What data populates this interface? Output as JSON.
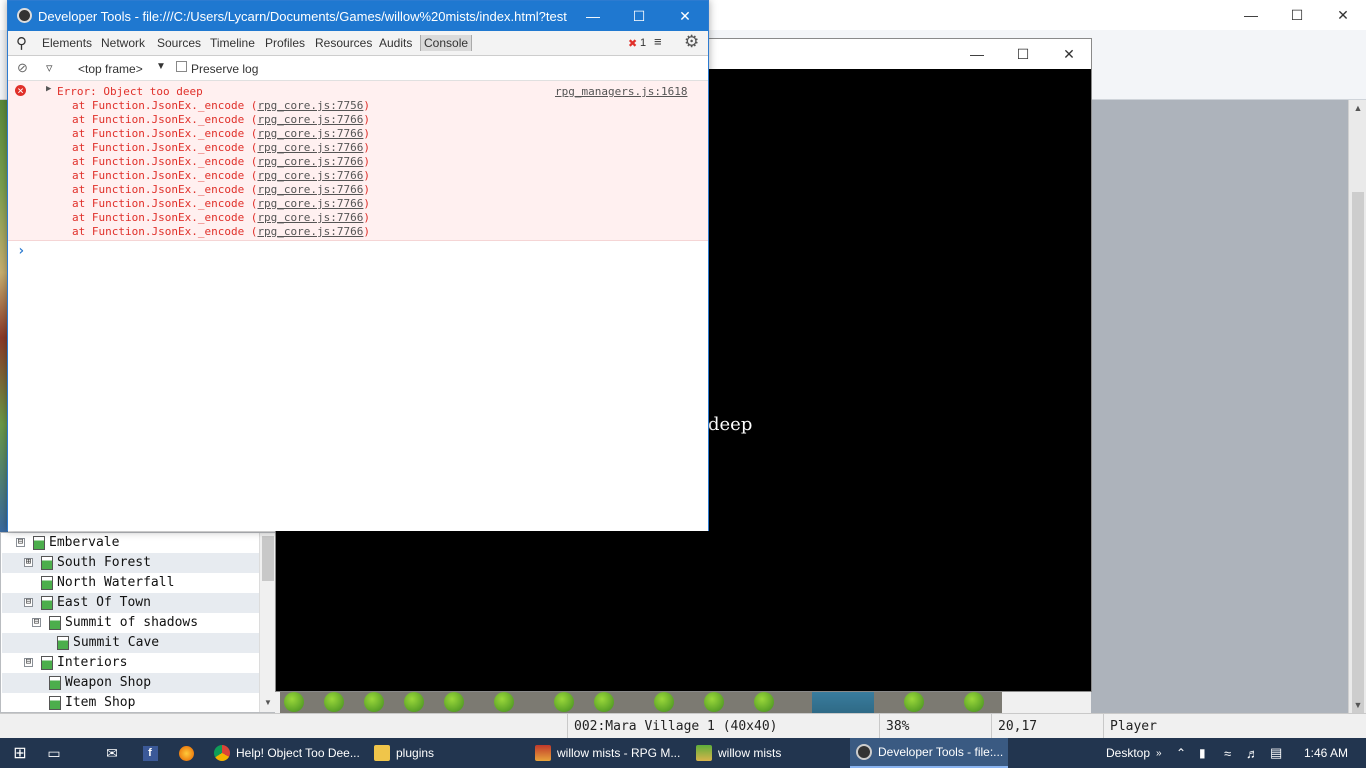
{
  "colors": {
    "devtools_accent": "#1f78d0",
    "error_red": "#e0302a",
    "taskbar": "#22354f"
  },
  "map_tree": {
    "items": [
      {
        "label": "Embervale",
        "toggle": "⊟"
      },
      {
        "label": "South Forest",
        "toggle": "⊞"
      },
      {
        "label": "North Waterfall",
        "toggle": ""
      },
      {
        "label": "East Of Town",
        "toggle": "⊟"
      },
      {
        "label": "Summit of shadows",
        "toggle": "⊟"
      },
      {
        "label": "Summit Cave",
        "toggle": ""
      },
      {
        "label": "Interiors",
        "toggle": "⊟"
      },
      {
        "label": "Weapon Shop",
        "toggle": ""
      },
      {
        "label": "Item Shop",
        "toggle": ""
      }
    ]
  },
  "statusbar": {
    "map": "002:Mara Village 1 (40x40)",
    "zoom": "38%",
    "coords": "20,17",
    "mode": "Player"
  },
  "game": {
    "message": "deep"
  },
  "devtools": {
    "title": "Developer Tools - file:///C:/Users/Lycarn/Documents/Games/willow%20mists/index.html?test",
    "tabs": [
      "Elements",
      "Network",
      "Sources",
      "Timeline",
      "Profiles",
      "Resources",
      "Audits",
      "Console"
    ],
    "error_count": "1",
    "frame": "<top frame>",
    "preserve_log": "Preserve log",
    "error": {
      "message": "Error: Object too deep",
      "source": "rpg_managers.js:1618",
      "stack": [
        {
          "text": "at Function.JsonEx._encode",
          "link": "rpg_core.js:7756"
        },
        {
          "text": "at Function.JsonEx._encode",
          "link": "rpg_core.js:7766"
        },
        {
          "text": "at Function.JsonEx._encode",
          "link": "rpg_core.js:7766"
        },
        {
          "text": "at Function.JsonEx._encode",
          "link": "rpg_core.js:7766"
        },
        {
          "text": "at Function.JsonEx._encode",
          "link": "rpg_core.js:7766"
        },
        {
          "text": "at Function.JsonEx._encode",
          "link": "rpg_core.js:7766"
        },
        {
          "text": "at Function.JsonEx._encode",
          "link": "rpg_core.js:7766"
        },
        {
          "text": "at Function.JsonEx._encode",
          "link": "rpg_core.js:7766"
        },
        {
          "text": "at Function.JsonEx._encode",
          "link": "rpg_core.js:7766"
        },
        {
          "text": "at Function.JsonEx._encode",
          "link": "rpg_core.js:7766"
        }
      ]
    },
    "prompt": "›"
  },
  "taskbar": {
    "items": [
      {
        "label": "Help! Object Too Dee...",
        "icon": "chrome-icon"
      },
      {
        "label": "plugins",
        "icon": "folder-icon"
      },
      {
        "label": "willow mists - RPG M...",
        "icon": "rpgmaker-icon"
      },
      {
        "label": "willow mists",
        "icon": "game-icon"
      },
      {
        "label": "Developer Tools - file:...",
        "icon": "devtools-icon"
      }
    ],
    "desktop": "Desktop",
    "time": "1:46 AM"
  }
}
